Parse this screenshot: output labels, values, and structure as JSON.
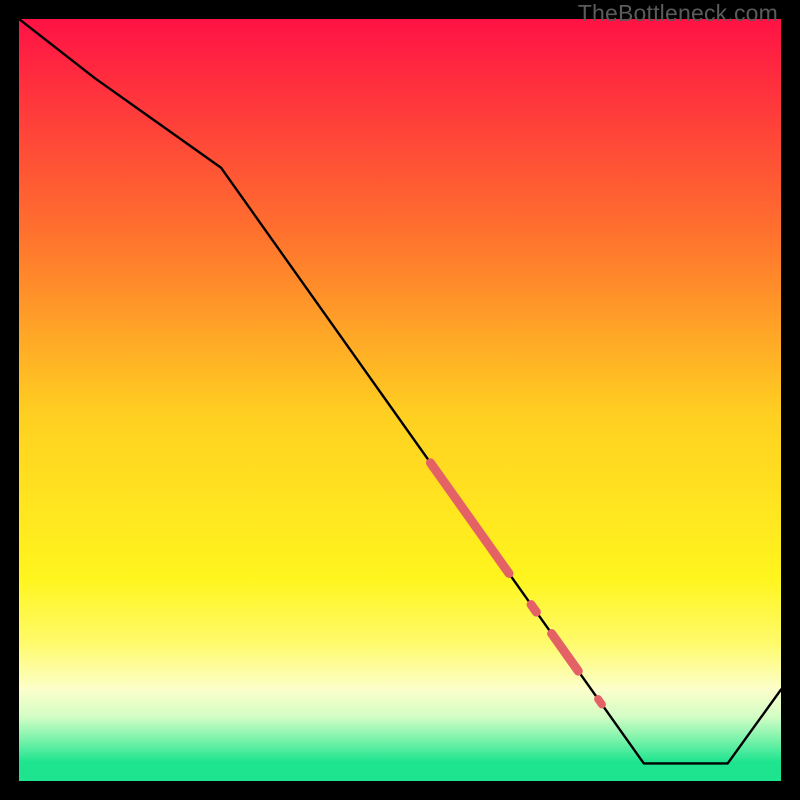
{
  "watermark": "TheBottleneck.com",
  "colors": {
    "gradient_stops": [
      {
        "offset": 0.0,
        "color": "#ff1245"
      },
      {
        "offset": 0.275,
        "color": "#ff6f2e"
      },
      {
        "offset": 0.52,
        "color": "#ffd021"
      },
      {
        "offset": 0.735,
        "color": "#fff51e"
      },
      {
        "offset": 0.82,
        "color": "#fffb6c"
      },
      {
        "offset": 0.88,
        "color": "#fcfecb"
      },
      {
        "offset": 0.915,
        "color": "#d4fdc5"
      },
      {
        "offset": 0.945,
        "color": "#7cf3ab"
      },
      {
        "offset": 0.975,
        "color": "#1ee48f"
      },
      {
        "offset": 1.0,
        "color": "#1ee48f"
      }
    ],
    "curve": "#000000",
    "markers": "#e46266",
    "frame": "#000000"
  },
  "chart_data": {
    "type": "line",
    "title": "",
    "xlabel": "",
    "ylabel": "",
    "xlim": [
      0,
      100
    ],
    "ylim": [
      0,
      100
    ],
    "curve": {
      "x": [
        0,
        10,
        26.5,
        82,
        93,
        100
      ],
      "y": [
        100,
        92.2,
        80.5,
        2.3,
        2.3,
        12.0
      ]
    },
    "markers": [
      {
        "x_start": 54.0,
        "x_end": 64.3,
        "thickness": 9
      },
      {
        "x_start": 67.2,
        "x_end": 67.9,
        "thickness": 9
      },
      {
        "x_start": 69.9,
        "x_end": 73.4,
        "thickness": 9
      },
      {
        "x_start": 76.0,
        "x_end": 76.5,
        "thickness": 8
      }
    ],
    "notes": "Marker y-values lie on the curve; segment from (26.5,80.5) to (82,2.3) is linear."
  }
}
